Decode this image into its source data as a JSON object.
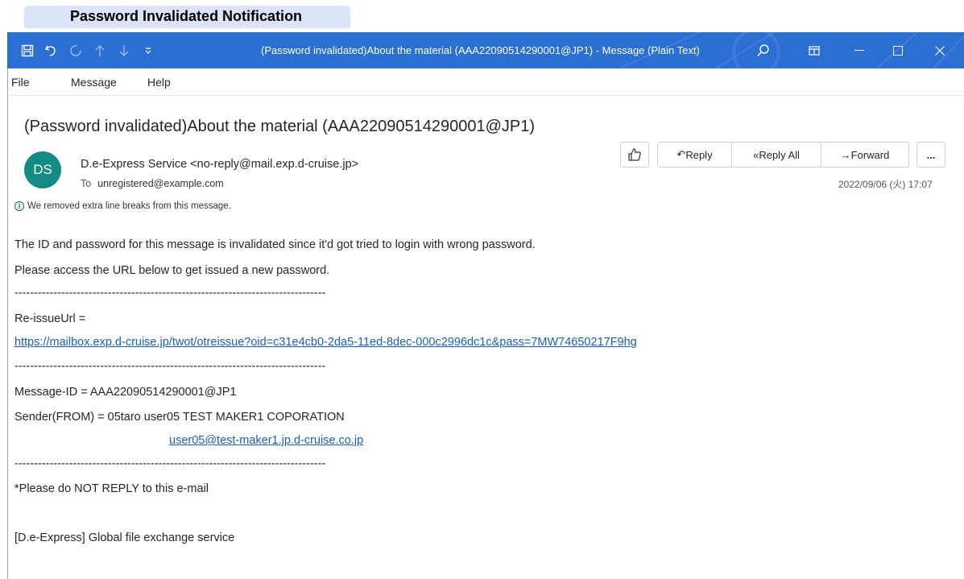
{
  "caption": "Password Invalidated Notification",
  "window": {
    "title": "(Password invalidated)About the material (AAA22090514290001@JP1)  -  Message (Plain Text)",
    "quick_access": {
      "save": "save-icon",
      "undo": "undo-icon",
      "redo": "redo-icon",
      "up": "arrow-up-icon",
      "down": "arrow-down-icon",
      "customize": "customize-icon"
    },
    "controls": {
      "search": "search-icon",
      "restore": "ribbon-display-icon",
      "minimize": "minimize-icon",
      "maximize": "maximize-icon",
      "close": "close-icon"
    },
    "accent": "#2b6fd3"
  },
  "menu": [
    "File",
    "Message",
    "Help"
  ],
  "message": {
    "subject": "(Password invalidated)About the material (AAA22090514290001@JP1)",
    "avatar_initials": "DS",
    "avatar_color": "#138a83",
    "sender": "D.e-Express Service <no-reply@mail.exp.d-cruise.jp>",
    "to_label": "To",
    "to": "unregistered@example.com",
    "info": "We removed extra line breaks from this message.",
    "date": "2022/09/06 (火) 17:07"
  },
  "actions": {
    "like": "like-icon",
    "reply": "Reply",
    "reply_all": "Reply All",
    "forward": "Forward",
    "more": "..."
  },
  "body": {
    "line1": "The ID and password for this message is invalidated since it'd got tried to login with wrong password.",
    "line2": "Please access the URL below to get issued a new password.",
    "divider": "--------------------------------------------------------------------------------",
    "reissue_label": "Re-issueUrl =",
    "reissue_url": "https://mailbox.exp.d-cruise.jp/twot/otreissue?oid=c31e4cb0-2da5-11ed-8dec-000c2996dc1c&pass=7MW74650217F9hg",
    "message_id": "Message-ID = AAA22090514290001@JP1",
    "sender_from": "Sender(FROM) = 05taro user05 TEST MAKER1 COPORATION",
    "sender_email": "user05@test-maker1.jp.d-cruise.co.jp",
    "no_reply": "*Please do NOT REPLY to this e-mail",
    "footer": "[D.e-Express] Global file exchange service"
  }
}
